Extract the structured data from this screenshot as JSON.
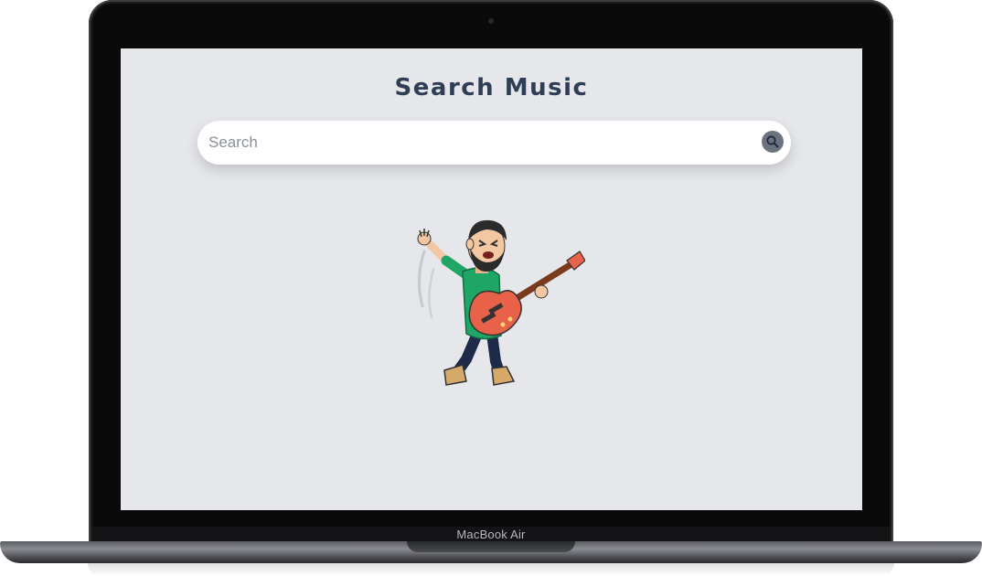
{
  "device": {
    "label": "MacBook Air"
  },
  "page": {
    "title": "Search Music"
  },
  "search": {
    "placeholder": "Search",
    "value": ""
  },
  "icons": {
    "search_button": "search-icon",
    "illustration": "guitar-player-avatar"
  },
  "colors": {
    "screen_background": "#e5e7eb",
    "title": "#2f3e55",
    "search_button": "#6b7280"
  }
}
